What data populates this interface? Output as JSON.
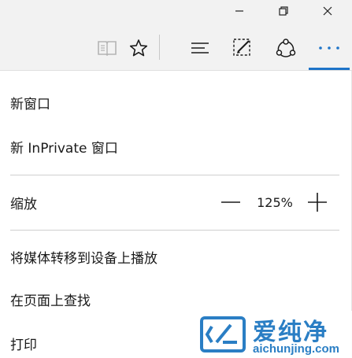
{
  "titlebar": {
    "minimize_icon": "minimize-icon",
    "restore_icon": "restore-icon",
    "close_icon": "close-icon"
  },
  "toolbar": {
    "icons": [
      "reading-view-icon",
      "favorite-star-icon",
      "hub-icon",
      "web-note-icon",
      "share-icon",
      "more-icon"
    ],
    "accent_color": "#1e74c8"
  },
  "menu": {
    "new_window": "新窗口",
    "new_inprivate_window": "新 InPrivate 窗口",
    "zoom_label": "缩放",
    "zoom_value": "125%",
    "cast_media": "将媒体转移到设备上播放",
    "find_on_page": "在页面上查找",
    "print": "打印"
  },
  "watermark": {
    "name": "爱纯净",
    "url": "aichunjing.com"
  }
}
